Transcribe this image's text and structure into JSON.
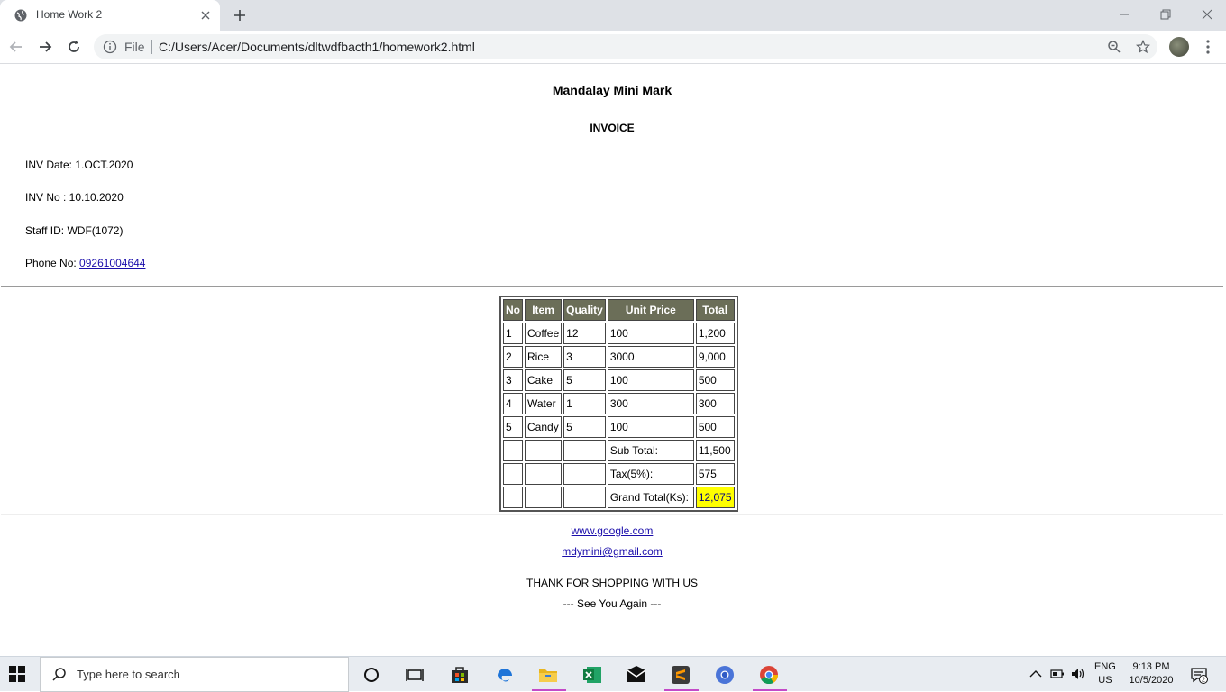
{
  "browser": {
    "tab_title": "Home Work 2",
    "omnibox_scheme": "File",
    "url": "C:/Users/Acer/Documents/dltwdfbacth1/homework2.html"
  },
  "page": {
    "store_name": "Mandalay Mini Mark",
    "invoice_title": "INVOICE",
    "inv_date": "INV Date: 1.OCT.2020",
    "inv_no": "INV No : 10.10.2020",
    "staff_id": "Staff ID: WDF(1072)",
    "phone_label": "Phone No: ",
    "phone_link": "09261004644",
    "table": {
      "headers": [
        "No",
        "Item",
        "Quality",
        "Unit Price",
        "Total"
      ],
      "rows": [
        [
          "1",
          "Coffee",
          "12",
          "100",
          "1,200"
        ],
        [
          "2",
          "Rice",
          "3",
          "3000",
          "9,000"
        ],
        [
          "3",
          "Cake",
          "5",
          "100",
          "500"
        ],
        [
          "4",
          "Water",
          "1",
          "300",
          "300"
        ],
        [
          "5",
          "Candy",
          "5",
          "100",
          "500"
        ]
      ],
      "subtotal_label": "Sub Total:",
      "subtotal_value": "11,500",
      "tax_label": "Tax(5%):",
      "tax_value": "575",
      "grand_label": "Grand Total(Ks):",
      "grand_value": "12,075"
    },
    "link_site": "www.google.com",
    "link_email": "mdymini@gmail.com",
    "thanks": "THANK FOR SHOPPING WITH US",
    "see_you": "--- See You Again ---"
  },
  "taskbar": {
    "search_placeholder": "Type here to search",
    "lang_top": "ENG",
    "lang_bottom": "US",
    "time": "9:13 PM",
    "date": "10/5/2020",
    "notification_count": "2"
  },
  "colors": {
    "table_header_bg": "#6b6e58",
    "grand_total_bg": "#ffff00",
    "link": "#1a0dab"
  }
}
